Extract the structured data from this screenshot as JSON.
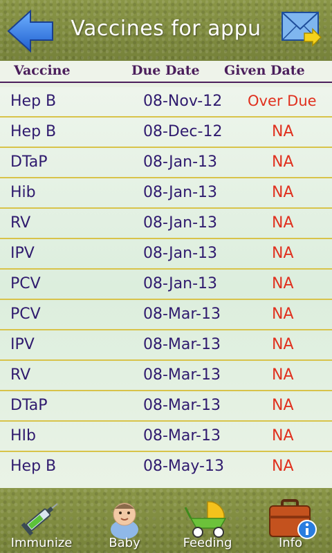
{
  "header": {
    "title": "Vaccines for appu"
  },
  "columns": {
    "vaccine": "Vaccine",
    "due": "Due Date",
    "given": "Given Date"
  },
  "rows": [
    {
      "vaccine": "Hep B",
      "due": "08-Nov-12",
      "given": "Over Due"
    },
    {
      "vaccine": "Hep B",
      "due": "08-Dec-12",
      "given": "NA"
    },
    {
      "vaccine": "DTaP",
      "due": "08-Jan-13",
      "given": "NA"
    },
    {
      "vaccine": "Hib",
      "due": "08-Jan-13",
      "given": "NA"
    },
    {
      "vaccine": "RV",
      "due": "08-Jan-13",
      "given": "NA"
    },
    {
      "vaccine": "IPV",
      "due": "08-Jan-13",
      "given": "NA"
    },
    {
      "vaccine": "PCV",
      "due": "08-Jan-13",
      "given": "NA"
    },
    {
      "vaccine": "PCV",
      "due": "08-Mar-13",
      "given": "NA"
    },
    {
      "vaccine": "IPV",
      "due": "08-Mar-13",
      "given": "NA"
    },
    {
      "vaccine": "RV",
      "due": "08-Mar-13",
      "given": "NA"
    },
    {
      "vaccine": "DTaP",
      "due": "08-Mar-13",
      "given": "NA"
    },
    {
      "vaccine": "HIb",
      "due": "08-Mar-13",
      "given": "NA"
    },
    {
      "vaccine": "Hep B",
      "due": "08-May-13",
      "given": "NA"
    }
  ],
  "tabs": [
    {
      "label": "Immunize",
      "icon": "syringe-icon"
    },
    {
      "label": "Baby",
      "icon": "baby-icon"
    },
    {
      "label": "Feeding",
      "icon": "stroller-icon"
    },
    {
      "label": "Info",
      "icon": "briefcase-info-icon"
    }
  ],
  "colors": {
    "header_bg": "#7f8c3e",
    "heading": "#4b1e5c",
    "text": "#2f1a6e",
    "alert": "#e0301e",
    "divider": "#d8c349"
  }
}
